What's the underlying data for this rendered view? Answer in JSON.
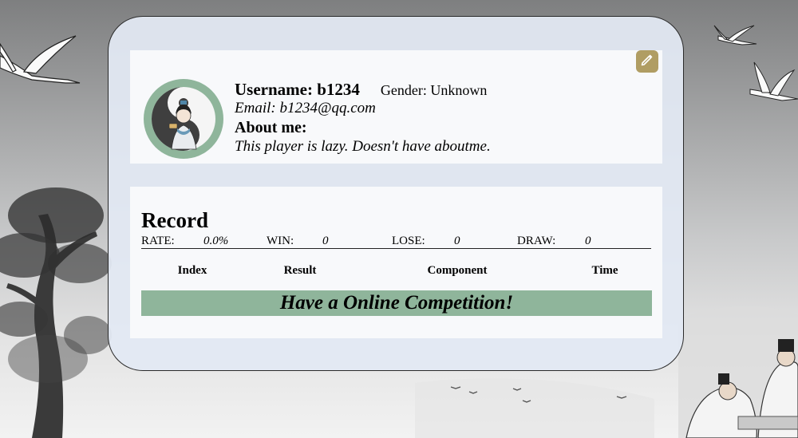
{
  "profile": {
    "username_label": "Username:",
    "username": "b1234",
    "gender_label": "Gender:",
    "gender": "Unknown",
    "email_label": "Email:",
    "email": "b1234@qq.com",
    "about_label": "About me:",
    "about_text": "This player is lazy. Doesn't have aboutme.",
    "edit_icon": "pencil-icon",
    "avatar_icon": "yin-yang-avatar"
  },
  "record": {
    "title": "Record",
    "stats": [
      {
        "label": "RATE:",
        "value": "0.0%"
      },
      {
        "label": "WIN:",
        "value": "0"
      },
      {
        "label": "LOSE:",
        "value": "0"
      },
      {
        "label": "DRAW:",
        "value": "0"
      }
    ],
    "columns": [
      "Index",
      "Result",
      "Component",
      "Time"
    ],
    "cta": "Have a Online Competition!"
  },
  "colors": {
    "accent_green": "#8fb59b",
    "edit_button": "#b09d63",
    "card_bg": "#e2e9f3"
  }
}
